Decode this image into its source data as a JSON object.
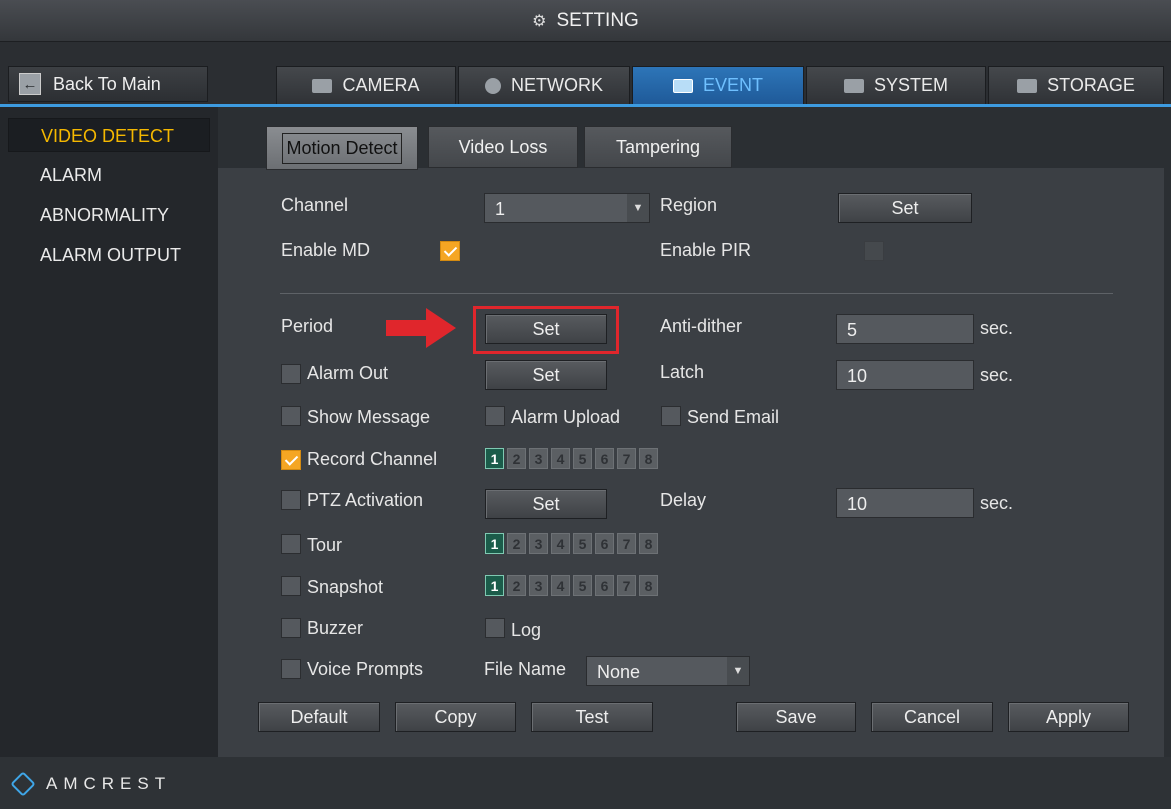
{
  "title": "SETTING",
  "back_label": "Back To Main",
  "main_tabs": [
    {
      "label": "CAMERA",
      "icon": "camera-icon"
    },
    {
      "label": "NETWORK",
      "icon": "globe-icon"
    },
    {
      "label": "EVENT",
      "icon": "event-icon",
      "active": true
    },
    {
      "label": "SYSTEM",
      "icon": "system-icon"
    },
    {
      "label": "STORAGE",
      "icon": "storage-icon"
    }
  ],
  "sidebar": [
    {
      "label": "VIDEO DETECT",
      "active": true
    },
    {
      "label": "ALARM"
    },
    {
      "label": "ABNORMALITY"
    },
    {
      "label": "ALARM OUTPUT"
    }
  ],
  "sub_tabs": [
    {
      "label": "Motion Detect",
      "active": true
    },
    {
      "label": "Video Loss"
    },
    {
      "label": "Tampering"
    }
  ],
  "form": {
    "channel_label": "Channel",
    "channel_value": "1",
    "region_label": "Region",
    "region_btn": "Set",
    "enable_md_label": "Enable MD",
    "enable_md": true,
    "enable_pir_label": "Enable PIR",
    "enable_pir": false,
    "period_label": "Period",
    "period_btn": "Set",
    "anti_dither_label": "Anti-dither",
    "anti_dither_value": "5",
    "anti_dither_unit": "sec.",
    "alarm_out_label": "Alarm Out",
    "alarm_out_btn": "Set",
    "latch_label": "Latch",
    "latch_value": "10",
    "latch_unit": "sec.",
    "show_message_label": "Show Message",
    "alarm_upload_label": "Alarm Upload",
    "send_email_label": "Send Email",
    "record_channel_label": "Record Channel",
    "record_channel": true,
    "ptz_label": "PTZ Activation",
    "ptz_btn": "Set",
    "delay_label": "Delay",
    "delay_value": "10",
    "delay_unit": "sec.",
    "tour_label": "Tour",
    "snapshot_label": "Snapshot",
    "buzzer_label": "Buzzer",
    "log_label": "Log",
    "voice_prompts_label": "Voice Prompts",
    "file_name_label": "File Name",
    "file_name_value": "None",
    "channels": [
      "1",
      "2",
      "3",
      "4",
      "5",
      "6",
      "7",
      "8"
    ]
  },
  "buttons": {
    "default": "Default",
    "copy": "Copy",
    "test": "Test",
    "save": "Save",
    "cancel": "Cancel",
    "apply": "Apply"
  },
  "brand": "AMCREST",
  "colors": {
    "accent": "#3d9be0",
    "active_side": "#f5b800",
    "checkbox_on": "#f5a623",
    "highlight": "#e0262c"
  }
}
